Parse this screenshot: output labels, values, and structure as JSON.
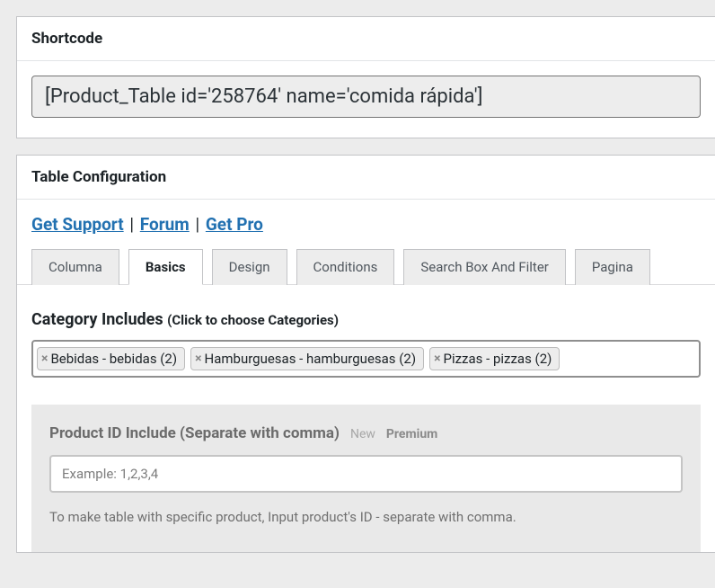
{
  "shortcode": {
    "title": "Shortcode",
    "value": "[Product_Table id='258764' name='comida rápida']"
  },
  "table_config": {
    "title": "Table Configuration",
    "links": {
      "support": "Get Support",
      "forum": "Forum",
      "pro": "Get Pro"
    },
    "tabs": [
      "Columna",
      "Basics",
      "Design",
      "Conditions",
      "Search Box And Filter",
      "Pagina"
    ],
    "active_tab_index": 1,
    "category_includes": {
      "label": "Category Includes",
      "hint": "(Click to choose Categories)",
      "tags": [
        "Bebidas - bebidas (2)",
        "Hamburguesas - hamburguesas (2)",
        "Pizzas - pizzas (2)"
      ]
    },
    "product_id_include": {
      "label": "Product ID Include (Separate with comma)",
      "new_label": "New",
      "premium_label": "Premium",
      "placeholder": "Example: 1,2,3,4",
      "help": "To make table with specific product, Input product's ID - separate with comma."
    }
  }
}
